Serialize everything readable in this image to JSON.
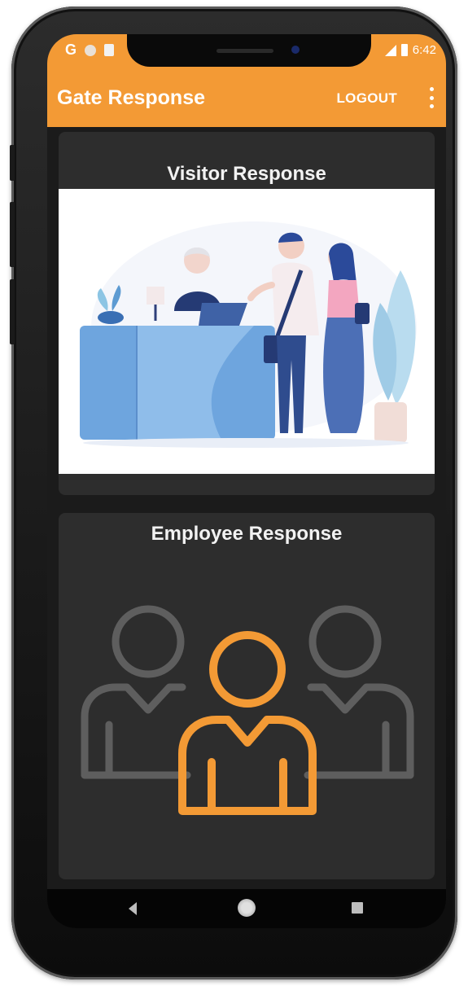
{
  "status_bar": {
    "left_glyph": "G",
    "time": "6:42",
    "icons": [
      "google-icon",
      "dot-icon",
      "sim-icon",
      "signal-icon",
      "battery-icon"
    ]
  },
  "app_bar": {
    "title": "Gate Response",
    "logout_label": "LOGOUT",
    "menu_icon": "overflow-menu-icon"
  },
  "cards": {
    "visitor": {
      "title": "Visitor Response",
      "image": "reception-desk-illustration"
    },
    "employee": {
      "title": "Employee Response",
      "image": "group-people-icon"
    }
  },
  "nav_bar": {
    "icons": [
      "back-icon",
      "home-icon",
      "recents-icon"
    ]
  },
  "colors": {
    "accent": "#f39a35",
    "card_bg": "#2d2d2d",
    "screen_bg": "#1b1b1b",
    "icon_gray": "#5e5e5e"
  }
}
